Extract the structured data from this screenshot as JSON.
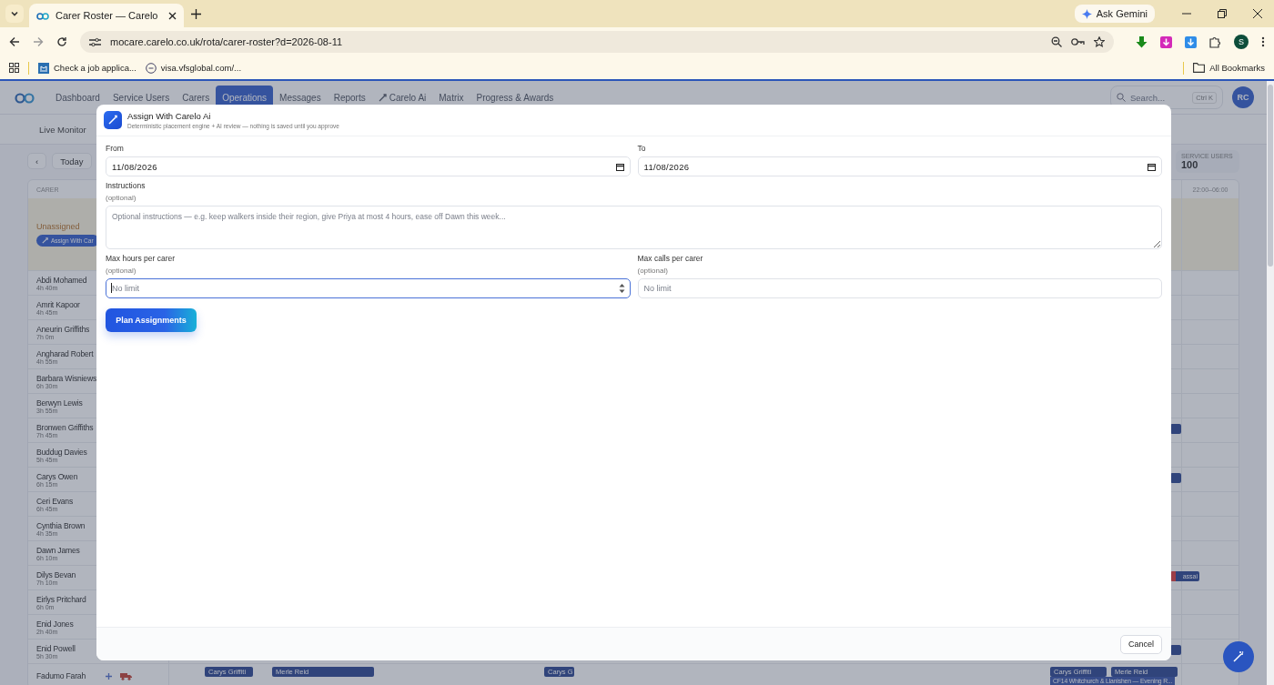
{
  "browser": {
    "tabs": [
      {
        "title": "Carer Roster — Carelo",
        "selected": true
      }
    ],
    "address": "mocare.carelo.co.uk/rota/carer-roster?d=2026-08-11",
    "ask_gemini": "Ask Gemini",
    "profile": "S",
    "bookmarks": [
      "Check a job applica...",
      "visa.vfsglobal.com/..."
    ],
    "all_bookmarks": "All Bookmarks"
  },
  "nav": {
    "items": [
      {
        "label": "Dashboard",
        "selected": false,
        "kind": "plain"
      },
      {
        "label": "Service Users",
        "selected": false,
        "kind": "plain"
      },
      {
        "label": "Carers",
        "selected": false,
        "kind": "plain"
      },
      {
        "label": "Operations",
        "selected": true,
        "kind": "plain"
      },
      {
        "label": "Messages",
        "selected": false,
        "kind": "plain"
      },
      {
        "label": "Reports",
        "selected": false,
        "kind": "plain"
      },
      {
        "label": "Carelo Ai",
        "selected": false,
        "kind": "ai"
      },
      {
        "label": "Matrix",
        "selected": false,
        "kind": "plain"
      },
      {
        "label": "Progress & Awards",
        "selected": false,
        "kind": "plain"
      }
    ],
    "search_placeholder": "Search...",
    "shortcut": "Ctrl K",
    "avatar": "RC"
  },
  "subnav": "Live Monitor",
  "toolbar": {
    "prev": "‹",
    "today": "Today"
  },
  "service_users": {
    "label": "SERVICE USERS",
    "value": "100"
  },
  "roster": {
    "carer_header": "CARER",
    "night_header": "22:00–06:00",
    "unassigned": {
      "label": "Unassigned",
      "button": "Assign With Car"
    },
    "carers": [
      {
        "name": "Abdi Mohamed",
        "hours": "4h 40m"
      },
      {
        "name": "Amrit Kapoor",
        "hours": "4h 45m"
      },
      {
        "name": "Aneurin Griffiths",
        "hours": "7h 0m"
      },
      {
        "name": "Angharad Robert",
        "hours": "4h 55m"
      },
      {
        "name": "Barbara Wisniews",
        "hours": "6h 30m"
      },
      {
        "name": "Berwyn Lewis",
        "hours": "3h 55m"
      },
      {
        "name": "Bronwen Griffiths",
        "hours": "7h 45m",
        "edge_chip": {
          "alert": false
        }
      },
      {
        "name": "Buddug Davies",
        "hours": "5h 45m"
      },
      {
        "name": "Carys Owen",
        "hours": "6h 15m",
        "edge_chip": {
          "alert": false
        }
      },
      {
        "name": "Ceri Evans",
        "hours": "6h 45m"
      },
      {
        "name": "Cynthia Brown",
        "hours": "4h 35m"
      },
      {
        "name": "Dawn James",
        "hours": "6h 10m"
      },
      {
        "name": "Dilys Bevan",
        "hours": "7h 10m",
        "edge_chip": {
          "alert": true,
          "text": "assai"
        }
      },
      {
        "name": "Eirlys Pritchard",
        "hours": "6h 0m"
      },
      {
        "name": "Enid Jones",
        "hours": "2h 40m"
      },
      {
        "name": "Enid Powell",
        "hours": "5h 30m",
        "edge_chip": {
          "alert": false
        }
      },
      {
        "name": "Fadumo Farah",
        "actions": true,
        "shifts": [
          "Carys Griffiti",
          "Merle Reid",
          "Carys G",
          "Carys Griffiti",
          "Merle Reid"
        ],
        "detail": "CF14 Whitchurch & Llanishen — Evening R..."
      }
    ]
  },
  "modal": {
    "title": "Assign With Carelo Ai",
    "subtitle": "Deterministic placement engine + AI review — nothing is saved until you approve",
    "from": {
      "label": "From",
      "value": "11/08/2026"
    },
    "to": {
      "label": "To",
      "value": "11/08/2026"
    },
    "instructions": {
      "label": "Instructions",
      "hint": "(optional)",
      "placeholder": "Optional instructions — e.g. keep walkers inside their region, give Priya at most 4 hours, ease off Dawn this week..."
    },
    "limits": [
      {
        "label": "Max hours per carer",
        "hint": "(optional)",
        "placeholder": "No limit",
        "focused": true
      },
      {
        "label": "Max calls per carer",
        "hint": "(optional)",
        "placeholder": "No limit",
        "focused": false
      }
    ],
    "primary": "Plan Assignments",
    "cancel": "Cancel"
  }
}
